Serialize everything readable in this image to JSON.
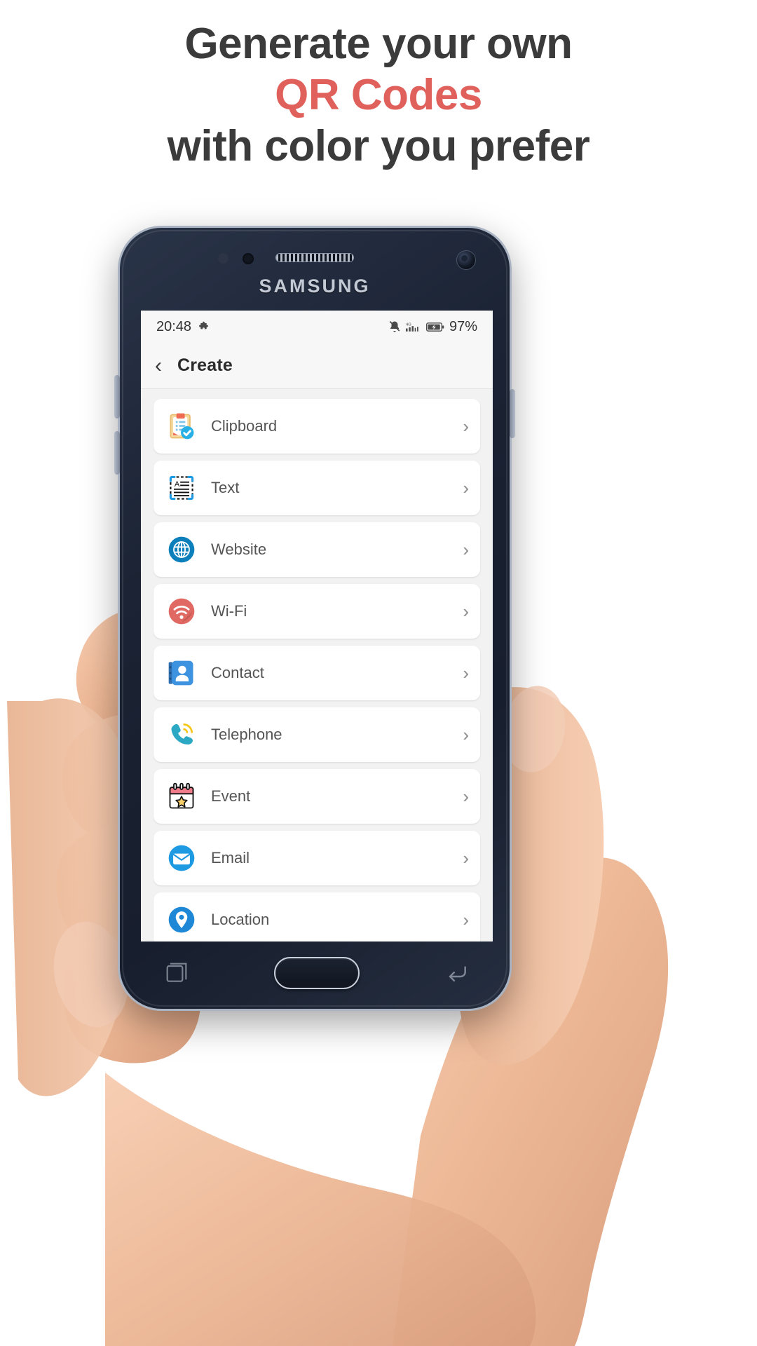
{
  "headline": {
    "line1": "Generate your own",
    "line2": "QR Codes",
    "line3": "with color you prefer",
    "accent_color": "#e0605c",
    "text_color": "#3b3b3b"
  },
  "device": {
    "brand": "SAMSUNG",
    "icons": {
      "earpiece": "speaker-grille-icon",
      "proximity": "proximity-sensor-icon",
      "front_camera": "front-camera-icon",
      "home": "home-button",
      "recents": "recents-icon",
      "back": "back-icon"
    }
  },
  "statusbar": {
    "time": "20:48",
    "left_icons": [
      "puzzle-piece-icon"
    ],
    "right_icons": [
      "mute-bell-icon",
      "signal-4g-icon",
      "battery-charging-icon"
    ],
    "network_label": "4G",
    "battery_percent": "97%"
  },
  "appbar": {
    "back_label": "‹",
    "title": "Create"
  },
  "list": {
    "chevron": "›",
    "items": [
      {
        "label": "Clipboard",
        "icon": "clipboard-check-icon",
        "color": "#f2c14e"
      },
      {
        "label": "Text",
        "icon": "text-scan-icon",
        "color": "#1f1f1f"
      },
      {
        "label": "Website",
        "icon": "globe-icon",
        "color": "#0d7fba"
      },
      {
        "label": "Wi-Fi",
        "icon": "wifi-icon",
        "color": "#e06a63"
      },
      {
        "label": "Contact",
        "icon": "contact-icon",
        "color": "#3d93df"
      },
      {
        "label": "Telephone",
        "icon": "telephone-icon",
        "color": "#2aa8c4"
      },
      {
        "label": "Event",
        "icon": "calendar-star-icon",
        "color": "#ef7b8b"
      },
      {
        "label": "Email",
        "icon": "email-icon",
        "color": "#1e9ae3"
      },
      {
        "label": "Location",
        "icon": "location-pin-icon",
        "color": "#1e88d6"
      }
    ]
  }
}
